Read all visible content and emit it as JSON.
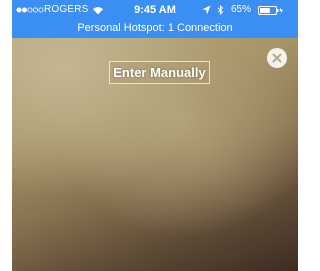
{
  "status_bar": {
    "carrier": "ROGERS",
    "time": "9:45 AM",
    "battery_percent": "65%",
    "battery_level": 0.65,
    "signal_bars_filled": 2,
    "signal_bars_total": 5,
    "icons": [
      "wifi-icon",
      "location-icon",
      "bluetooth-icon",
      "battery-icon"
    ]
  },
  "hotspot_banner": {
    "text": "Personal Hotspot: 1 Connection"
  },
  "scanner": {
    "enter_manually_label": "Enter Manually",
    "close_icon": "close-icon"
  },
  "colors": {
    "status_bar_bg": "#3b8ef2",
    "text": "#ffffff"
  }
}
